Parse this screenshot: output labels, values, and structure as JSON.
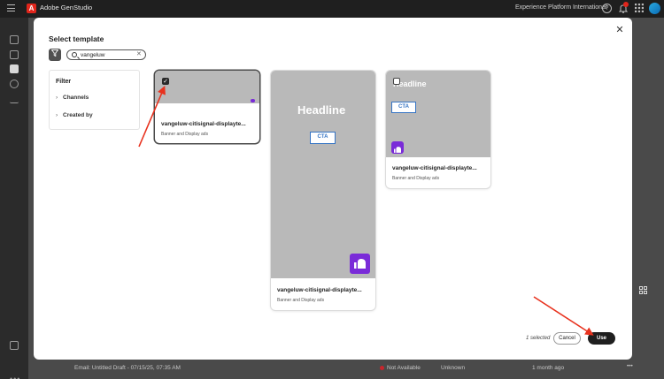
{
  "app": {
    "title": "Adobe GenStudio",
    "org_name": "Experience Platform International",
    "logo_letter": "A"
  },
  "topbar": {
    "help_glyph": "?",
    "bell_glyph": "🔔",
    "apps_glyph": "⁞⁞⁞"
  },
  "rail": {
    "items": [
      "home-icon",
      "templates-icon",
      "create-icon",
      "content-icon",
      "insights-icon"
    ],
    "bottom_icon": "shield-icon",
    "more_glyph": "•••"
  },
  "modal": {
    "title": "Select template",
    "close_glyph": "✕",
    "search": {
      "value": "vangeluw",
      "placeholder": "Search",
      "clear_glyph": "✕"
    },
    "filter": {
      "heading": "Filter",
      "items": [
        "Channels",
        "Created by"
      ],
      "chevron": "›"
    },
    "templates": [
      {
        "name": "vangeluw-citisignal-displayte...",
        "type": "Banner and Display ads",
        "selected": true,
        "headline": "",
        "cta": ""
      },
      {
        "name": "vangeluw-citisignal-displayte...",
        "type": "Banner and Display ads",
        "selected": false,
        "headline": "Headline",
        "cta": "CTA"
      },
      {
        "name": "vangeluw-citisignal-displayte...",
        "type": "Banner and Display ads",
        "selected": false,
        "headline": "Headline",
        "cta": "CTA"
      }
    ],
    "footer": {
      "selected_text": "1 selected",
      "cancel_label": "Cancel",
      "use_label": "Use"
    }
  },
  "background_row": {
    "name": "Email: Untitled Draft - 07/15/25, 07:35 AM",
    "status": "Not Available",
    "owner": "Unknown",
    "modified": "1 month ago",
    "more_glyph": "•••"
  },
  "colors": {
    "accent_purple": "#7a2bd8",
    "cta_blue": "#3574c4",
    "arrow_red": "#e8321e",
    "status_red": "#c9252c"
  }
}
